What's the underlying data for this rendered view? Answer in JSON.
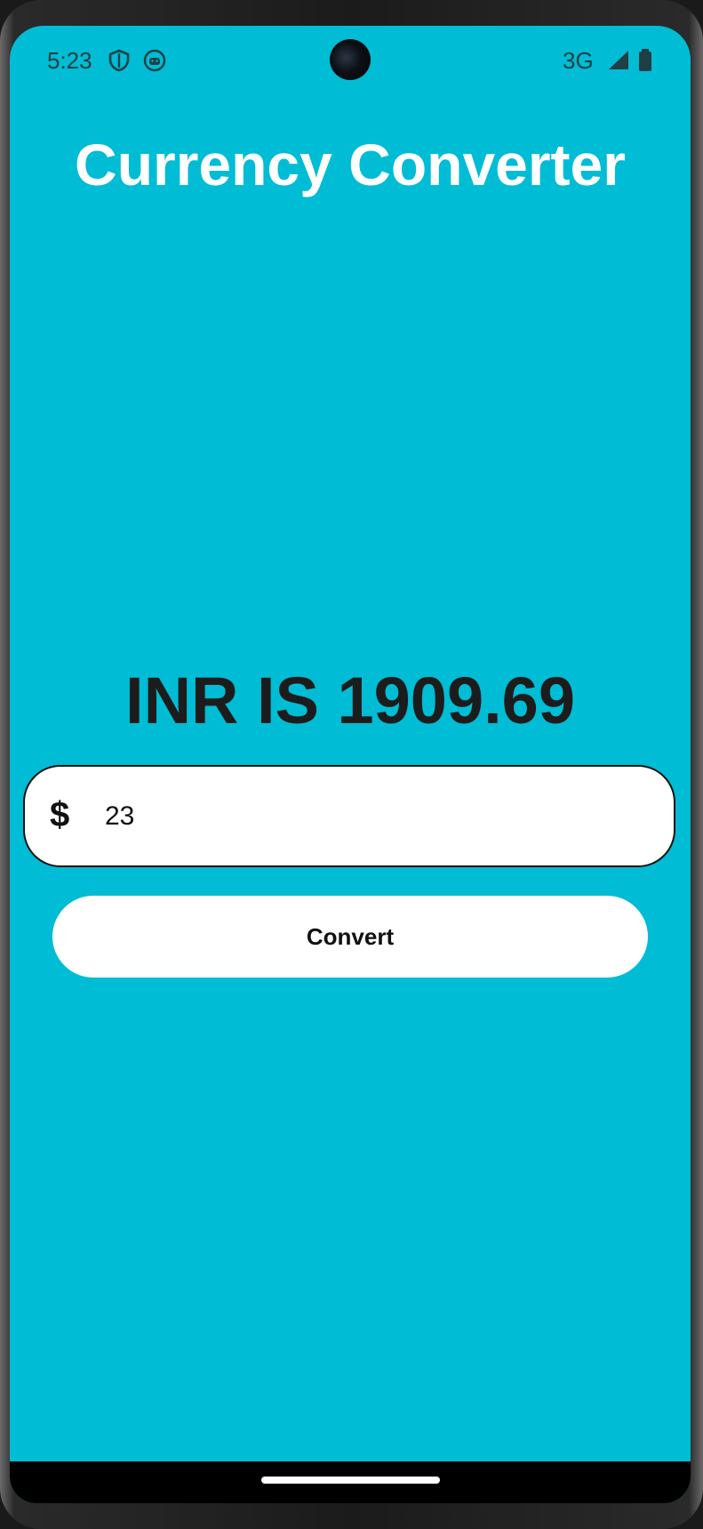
{
  "status_bar": {
    "time": "5:23",
    "network": "3G",
    "icons": [
      "shield-icon",
      "android-icon",
      "signal-icon",
      "battery-icon"
    ]
  },
  "app": {
    "title": "Currency Converter",
    "result": "INR IS 1909.69",
    "currency_symbol": "$",
    "amount_value": "23",
    "convert_label": "Convert"
  },
  "colors": {
    "background": "#00bcd4",
    "title": "#ffffff",
    "result_text": "#1c1c1c",
    "field_background": "#ffffff",
    "button_background": "#ffffff"
  }
}
